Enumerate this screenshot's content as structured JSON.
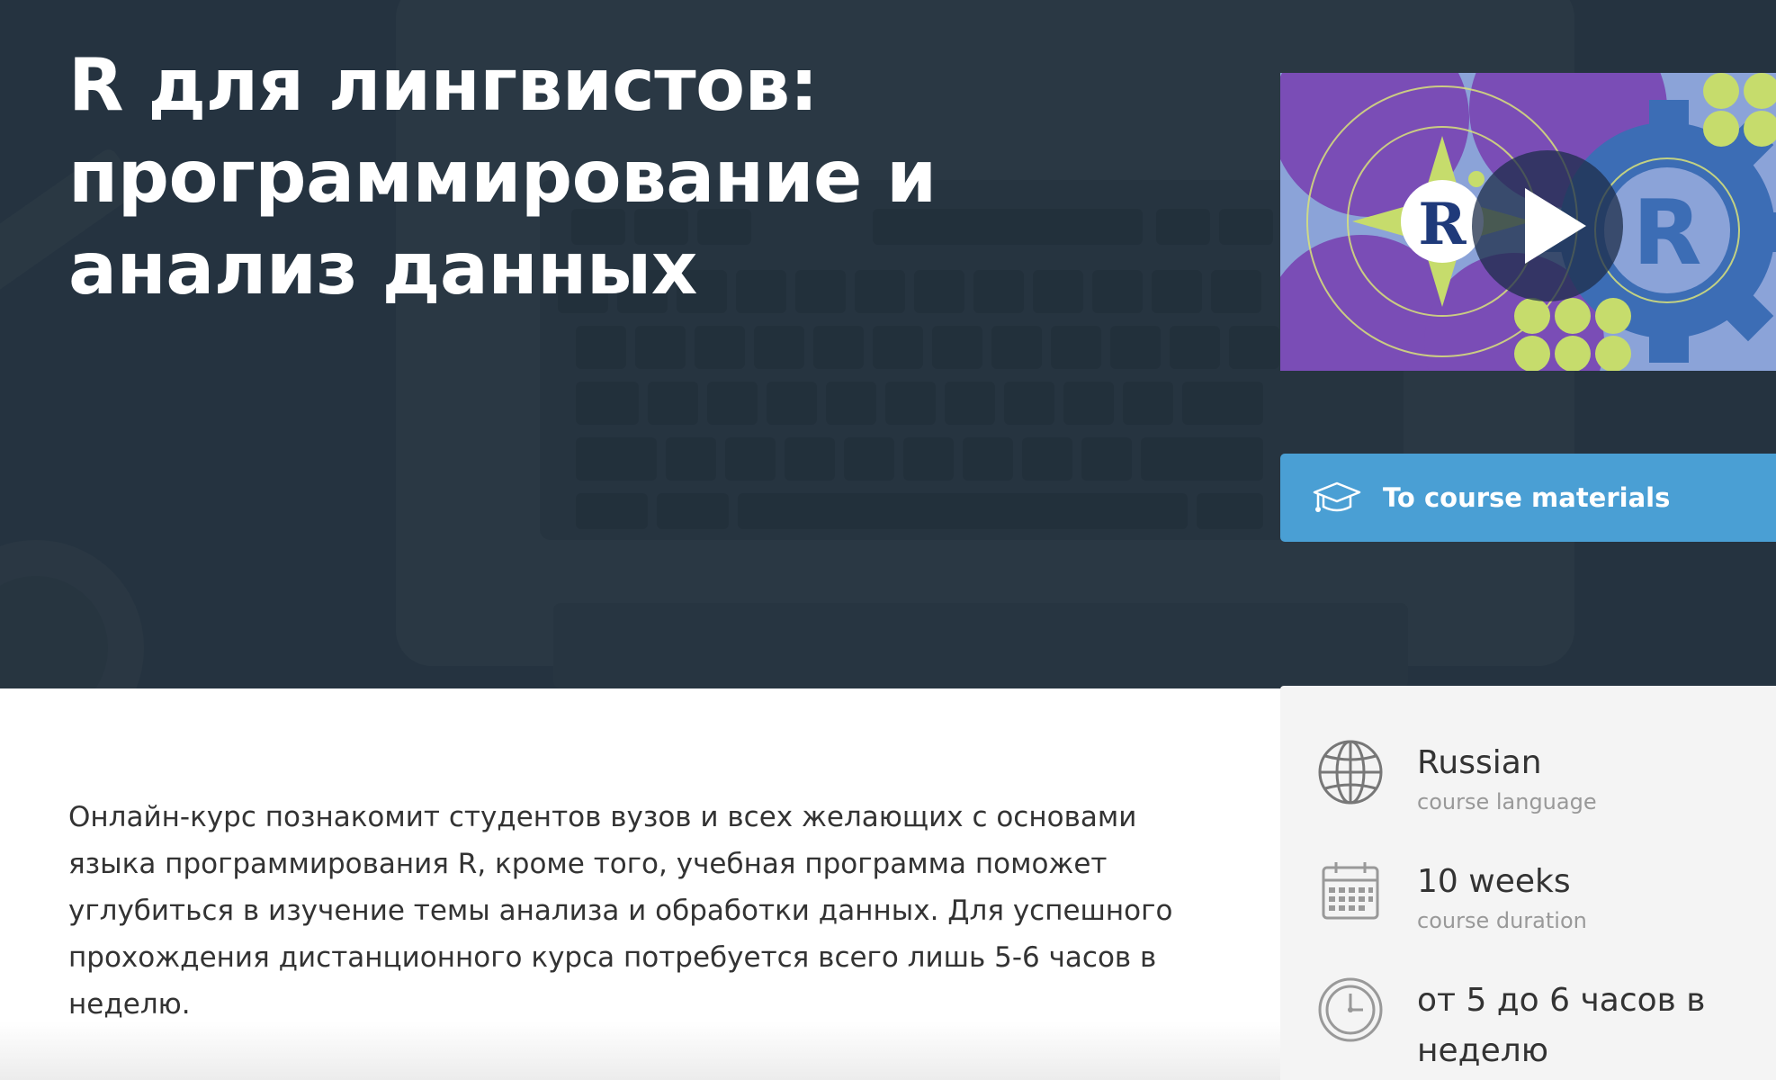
{
  "course": {
    "title": "R для лингвистов: программирование и анализ данных",
    "description": "Онлайн-курс познакомит студентов вузов и всех желающих с основами языка программирования R, кроме того, учебная программа поможет углубиться в изучение темы анализа и обработки данных. Для успешного прохождения дистанционного курса потребуется всего лишь 5-6 часов в неделю."
  },
  "video": {
    "logo_letter": "R",
    "icon": "play-icon"
  },
  "cta": {
    "label": "To course materials",
    "icon": "graduation-cap-icon"
  },
  "info": [
    {
      "value": "Russian",
      "caption": "course language",
      "icon": "globe-icon"
    },
    {
      "value": "10 weeks",
      "caption": "course duration",
      "icon": "calendar-icon"
    },
    {
      "value": "от 5 до 6 часов в неделю",
      "caption": "",
      "icon": "clock-icon"
    }
  ],
  "colors": {
    "hero_bg": "#2b3a48",
    "cta_bg": "#4a9fd4",
    "purple": "#7b4fb8",
    "lime": "#c4dc6a",
    "r_blue": "#3d6fb6"
  }
}
